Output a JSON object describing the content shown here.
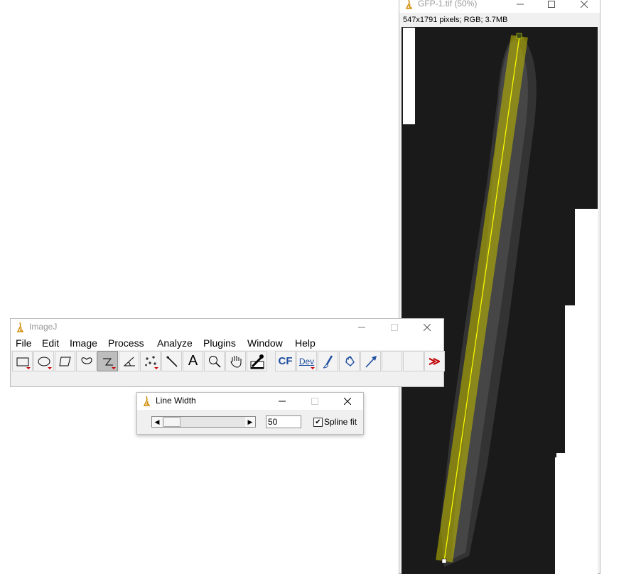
{
  "image_window": {
    "title": "GFP-1.tif (50%)",
    "info": "547x1791 pixels; RGB; 3.7MB",
    "icon": "imagej-microscope-icon"
  },
  "imagej_window": {
    "title": "ImageJ",
    "icon": "imagej-microscope-icon",
    "menus": [
      "File",
      "Edit",
      "Image",
      "Process",
      "Analyze",
      "Plugins",
      "Window",
      "Help"
    ],
    "tools": [
      {
        "name": "rectangle-tool-icon"
      },
      {
        "name": "oval-tool-icon"
      },
      {
        "name": "polygon-tool-icon"
      },
      {
        "name": "freehand-tool-icon"
      },
      {
        "name": "segmented-line-tool-icon",
        "active": true
      },
      {
        "name": "angle-tool-icon"
      },
      {
        "name": "point-tool-icon"
      },
      {
        "name": "wand-tool-icon"
      },
      {
        "name": "text-tool-icon",
        "label": "A"
      },
      {
        "name": "magnifier-tool-icon"
      },
      {
        "name": "hand-tool-icon"
      },
      {
        "name": "color-picker-tool-icon"
      },
      {
        "name": "cf-tool",
        "label": "CF"
      },
      {
        "name": "dev-tool",
        "label": "Dev"
      },
      {
        "name": "brush-tool-icon"
      },
      {
        "name": "flood-fill-tool-icon"
      },
      {
        "name": "arrow-tool-icon"
      },
      {
        "name": "empty-tool-1"
      },
      {
        "name": "empty-tool-2"
      },
      {
        "name": "more-tools-icon",
        "label": "≫"
      }
    ]
  },
  "line_width_dialog": {
    "title": "Line Width",
    "value": "50",
    "spline_fit_label": "Spline fit",
    "spline_fit_checked": true
  },
  "colors": {
    "selection_yellow": "#ffff00",
    "band_fill": "#b8b400",
    "image_bg": "#1a1a1a",
    "accent_blue": "#1f4fa0",
    "more_red": "#c00000"
  }
}
